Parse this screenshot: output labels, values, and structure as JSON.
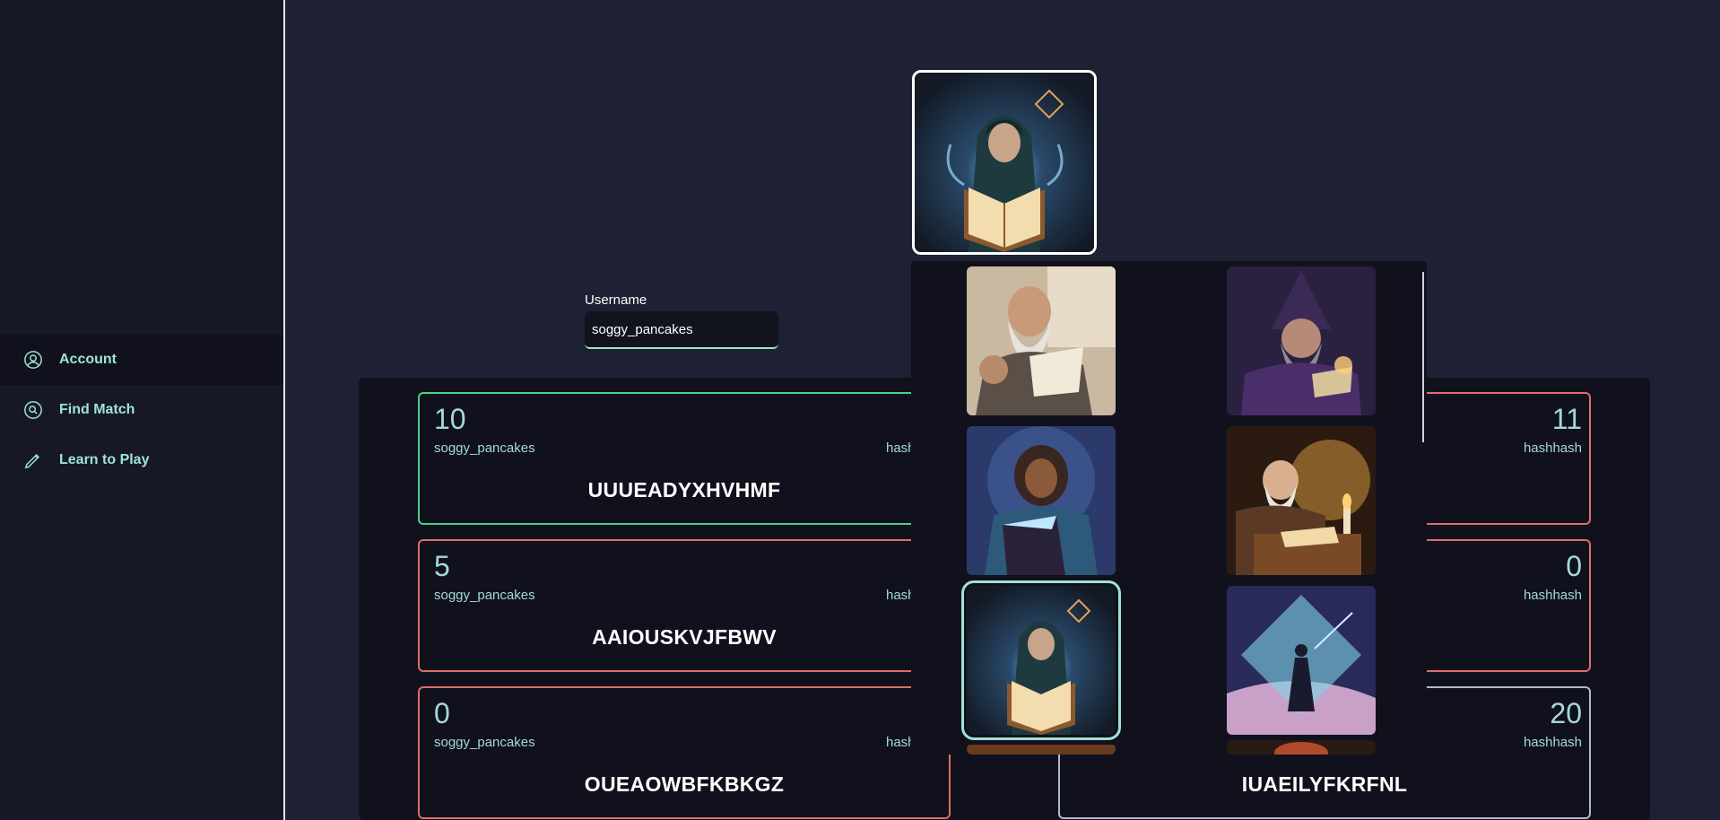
{
  "sidebar": {
    "items": [
      {
        "label": "Account",
        "icon": "user-circle-icon",
        "active": true
      },
      {
        "label": "Find Match",
        "icon": "search-circle-icon",
        "active": false
      },
      {
        "label": "Learn to Play",
        "icon": "pencil-icon",
        "active": false
      }
    ]
  },
  "profile": {
    "username_label": "Username",
    "username_value": "soggy_pancakes"
  },
  "matches": [
    {
      "left_score": "10",
      "left_player": "soggy_pancakes",
      "right_score": "11",
      "right_player": "hashhash",
      "word": "UUUEADYXHVHMF",
      "right_word": "",
      "result": "win"
    },
    {
      "left_score": "5",
      "left_player": "soggy_pancakes",
      "right_score": "0",
      "right_player": "hashhash",
      "word": "AAIOUSKVJFBWV",
      "right_word": "",
      "result": "loss"
    },
    {
      "left_score": "0",
      "left_player": "soggy_pancakes",
      "right_score": "20",
      "right_player": "hashhash",
      "word": "OUEAOWBFKBKGZ",
      "right_word": "IUAEILYFKRFNL",
      "result": "loss"
    }
  ],
  "partial_labels": {
    "hash": "hash",
    "loss_hint": "1"
  },
  "avatar_picker": {
    "options": [
      {
        "name": "dwarf-reading-scroll",
        "selected": false
      },
      {
        "name": "wizard-reading-book",
        "selected": false
      },
      {
        "name": "woman-reading-glowing-book",
        "selected": false
      },
      {
        "name": "old-man-writing-candlelight",
        "selected": false
      },
      {
        "name": "hooded-mage-glowing-book",
        "selected": true
      },
      {
        "name": "wanderer-crystal-sky",
        "selected": false
      }
    ]
  },
  "colors": {
    "accent": "#9fe3d3",
    "win": "#4ccf86",
    "loss": "#e06c6c",
    "background": "#1d2133",
    "panel": "#10111c"
  }
}
